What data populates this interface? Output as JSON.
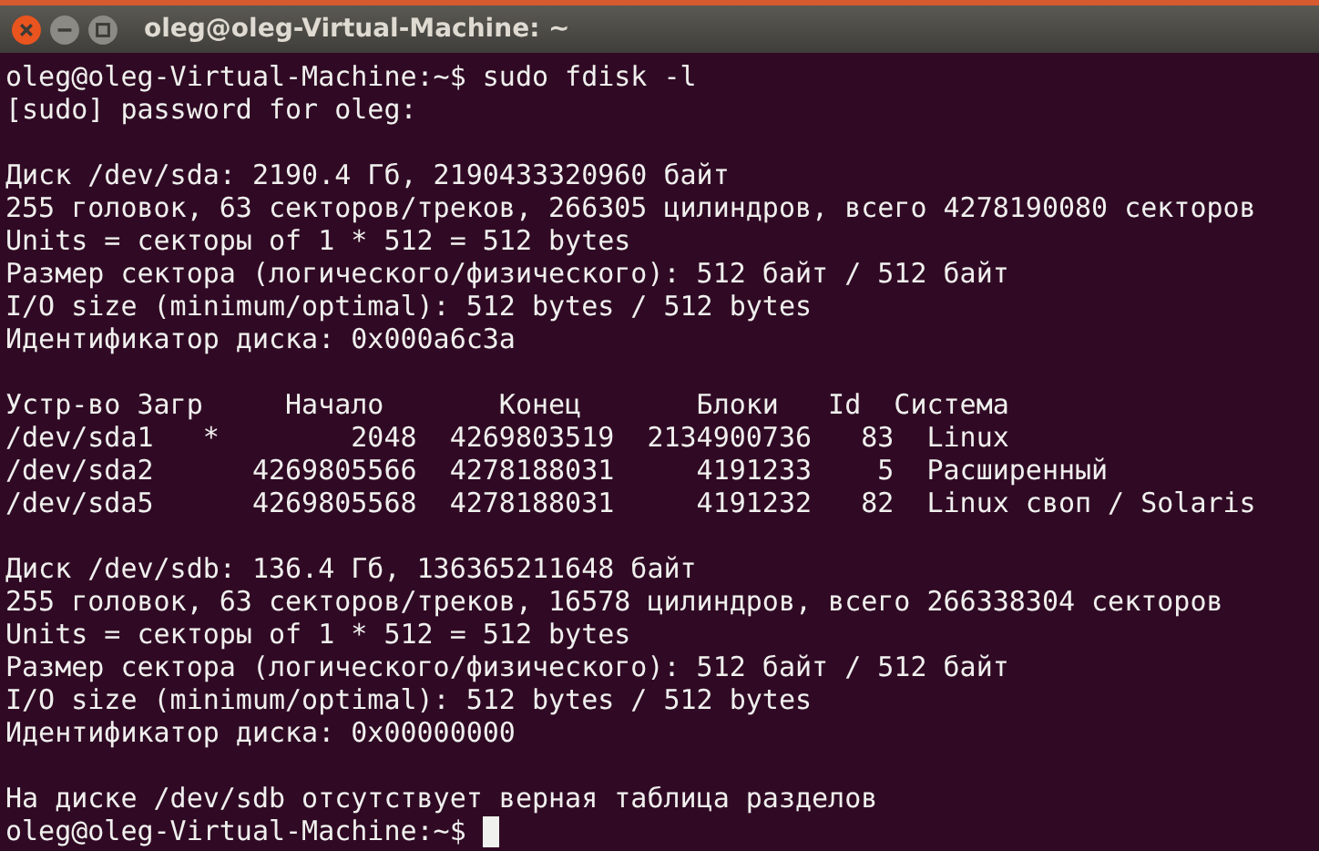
{
  "window": {
    "title": "oleg@oleg-Virtual-Machine: ~",
    "controls": [
      {
        "kind": "close"
      },
      {
        "kind": "minimize"
      },
      {
        "kind": "maximize"
      }
    ]
  },
  "terminal": {
    "blocks": [
      [
        "oleg@oleg-Virtual-Machine:~$ sudo fdisk -l",
        "[sudo] password for oleg:"
      ],
      [
        "Диск /dev/sda: 2190.4 Гб, 2190433320960 байт",
        "255 головок, 63 секторов/треков, 266305 цилиндров, всего 4278190080 секторов",
        "Units = секторы of 1 * 512 = 512 bytes",
        "Размер сектора (логического/физического): 512 байт / 512 байт",
        "I/O size (minimum/optimal): 512 bytes / 512 bytes",
        "Идентификатор диска: 0x000a6c3a"
      ],
      [
        "Устр-во Загр     Начало       Конец       Блоки   Id  Система",
        "/dev/sda1   *        2048  4269803519  2134900736   83  Linux",
        "/dev/sda2      4269805566  4278188031     4191233    5  Расширенный",
        "/dev/sda5      4269805568  4278188031     4191232   82  Linux своп / Solaris"
      ],
      [
        "Диск /dev/sdb: 136.4 Гб, 136365211648 байт",
        "255 головок, 63 секторов/треков, 16578 цилиндров, всего 266338304 секторов",
        "Units = секторы of 1 * 512 = 512 bytes",
        "Размер сектора (логического/физического): 512 байт / 512 байт",
        "I/O size (minimum/optimal): 512 bytes / 512 bytes",
        "Идентификатор диска: 0x00000000"
      ],
      [
        "На диске /dev/sdb отсутствует верная таблица разделов"
      ]
    ],
    "prompt": "oleg@oleg-Virtual-Machine:~$"
  }
}
